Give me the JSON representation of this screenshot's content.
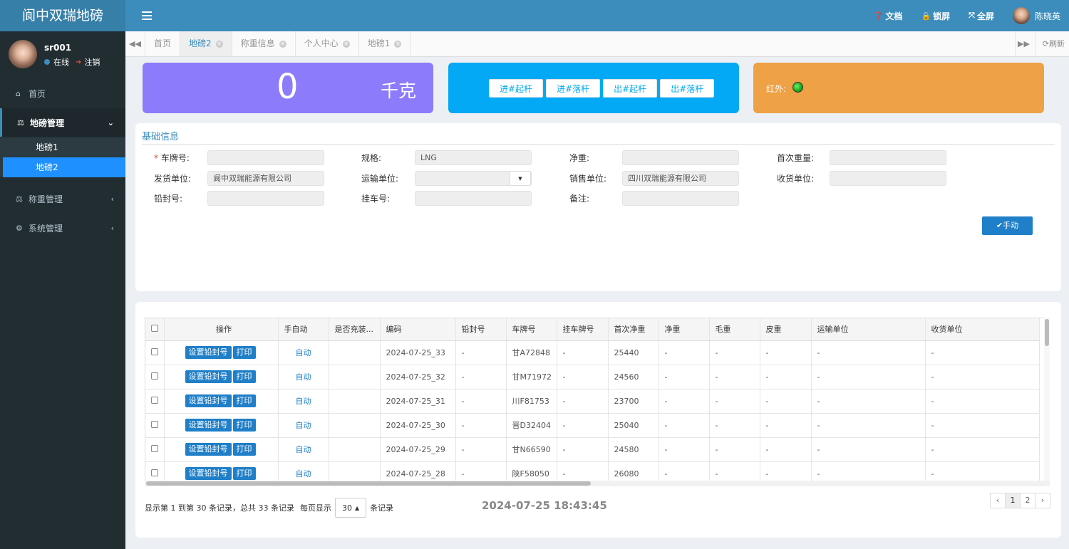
{
  "app": {
    "title": "阆中双瑞地磅"
  },
  "topbar": {
    "doc": "文档",
    "lock": "锁屏",
    "fullscreen": "全屏",
    "username": "陈晓英"
  },
  "sidebar": {
    "user": {
      "name": "sr001",
      "status": "在线",
      "logout": "注销"
    },
    "home": "首页",
    "weighbridge_mgmt": "地磅管理",
    "sub_items": [
      "地磅1",
      "地磅2"
    ],
    "weighing_mgmt": "称重管理",
    "system_mgmt": "系统管理"
  },
  "tabs": {
    "items": [
      "首页",
      "地磅2",
      "称重信息",
      "个人中心",
      "地磅1"
    ],
    "active": "地磅2",
    "refresh": "刷新"
  },
  "weight": {
    "value": "0",
    "unit": "千克"
  },
  "gate_buttons": [
    "进#起杆",
    "进#落杆",
    "出#起杆",
    "出#落杆"
  ],
  "infrared": {
    "label": "红外:",
    "status_color": "#18a718"
  },
  "basic_info": {
    "title": "基础信息",
    "fields": {
      "plate": {
        "label": "车牌号:",
        "value": ""
      },
      "spec": {
        "label": "规格:",
        "value": "LNG"
      },
      "net": {
        "label": "净重:",
        "value": ""
      },
      "first_weight": {
        "label": "首次重量:",
        "value": ""
      },
      "shipper": {
        "label": "发货单位:",
        "value": "阆中双瑞能源有限公司"
      },
      "carrier": {
        "label": "运输单位:",
        "value": ""
      },
      "seller": {
        "label": "销售单位:",
        "value": "四川双瑞能源有限公司"
      },
      "receiver": {
        "label": "收货单位:",
        "value": ""
      },
      "seal": {
        "label": "铅封号:",
        "value": ""
      },
      "trailer": {
        "label": "挂车号:",
        "value": ""
      },
      "remark": {
        "label": "备注:",
        "value": ""
      }
    },
    "manual_button": "✔手动"
  },
  "table": {
    "headers": [
      "操作",
      "手自动",
      "是否充装...",
      "编码",
      "铅封号",
      "车牌号",
      "挂车牌号",
      "首次净重",
      "净重",
      "毛重",
      "皮重",
      "运输单位",
      "收货单位"
    ],
    "action_labels": {
      "set_seal": "设置铅封号",
      "print": "打印"
    },
    "rows": [
      {
        "mode": "自动",
        "filled": "",
        "code": "2024-07-25_33",
        "seal": "-",
        "plate": "甘A72848",
        "trailer": "-",
        "first_net": "25440",
        "net": "-",
        "gross": "-",
        "tare": "-",
        "carrier": "-",
        "receiver": "-"
      },
      {
        "mode": "自动",
        "filled": "",
        "code": "2024-07-25_32",
        "seal": "-",
        "plate": "甘M71972",
        "trailer": "-",
        "first_net": "24560",
        "net": "-",
        "gross": "-",
        "tare": "-",
        "carrier": "-",
        "receiver": "-"
      },
      {
        "mode": "自动",
        "filled": "",
        "code": "2024-07-25_31",
        "seal": "-",
        "plate": "川F81753",
        "trailer": "-",
        "first_net": "23700",
        "net": "-",
        "gross": "-",
        "tare": "-",
        "carrier": "-",
        "receiver": "-"
      },
      {
        "mode": "自动",
        "filled": "",
        "code": "2024-07-25_30",
        "seal": "-",
        "plate": "晋D32404",
        "trailer": "-",
        "first_net": "25040",
        "net": "-",
        "gross": "-",
        "tare": "-",
        "carrier": "-",
        "receiver": "-"
      },
      {
        "mode": "自动",
        "filled": "",
        "code": "2024-07-25_29",
        "seal": "-",
        "plate": "甘N66590",
        "trailer": "-",
        "first_net": "24580",
        "net": "-",
        "gross": "-",
        "tare": "-",
        "carrier": "-",
        "receiver": "-"
      },
      {
        "mode": "自动",
        "filled": "",
        "code": "2024-07-25_28",
        "seal": "-",
        "plate": "陕F58050",
        "trailer": "-",
        "first_net": "26080",
        "net": "-",
        "gross": "-",
        "tare": "-",
        "carrier": "-",
        "receiver": "-"
      }
    ]
  },
  "pagination": {
    "summary": "显示第 1 到第 30 条记录，总共 33 条记录",
    "per_page_prefix": "每页显示",
    "per_page": "30",
    "per_page_suffix": "条记录",
    "pages": [
      "‹",
      "1",
      "2",
      "›"
    ],
    "current_page": "1"
  },
  "clock": "2024-07-25 18:43:45",
  "colors": {
    "topbar": "#3c8dbc",
    "sidebar": "#222d32",
    "weight_card": "#8c7bfa",
    "gate_card": "#03a9f4",
    "infrared_card": "#eea145",
    "primary_button": "#1f7fc8"
  }
}
